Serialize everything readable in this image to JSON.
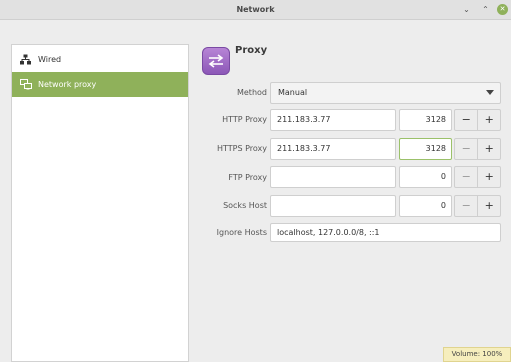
{
  "window": {
    "title": "Network",
    "minimize_glyph": "⌄",
    "maximize_glyph": "⌃",
    "close_glyph": "✕"
  },
  "sidebar": {
    "items": [
      {
        "label": "Wired",
        "icon": "network-wired-icon",
        "selected": false
      },
      {
        "label": "Network proxy",
        "icon": "network-proxy-icon",
        "selected": true
      }
    ]
  },
  "proxy": {
    "title": "Proxy",
    "method": {
      "label": "Method",
      "value": "Manual"
    },
    "http": {
      "label": "HTTP Proxy",
      "host": "211.183.3.77",
      "port": "3128"
    },
    "https": {
      "label": "HTTPS Proxy",
      "host": "211.183.3.77",
      "port": "3128"
    },
    "ftp": {
      "label": "FTP Proxy",
      "host": "",
      "port": "0"
    },
    "socks": {
      "label": "Socks Host",
      "host": "",
      "port": "0"
    },
    "ignore": {
      "label": "Ignore Hosts",
      "value": "localhost, 127.0.0.0/8, ::1"
    },
    "stepper": {
      "minus": "−",
      "plus": "+"
    }
  },
  "status": {
    "text": "Volume: 100%"
  },
  "colors": {
    "accent": "#8fb15a",
    "icon_purple": "#9a63c4",
    "status_bg": "#f6eebd"
  }
}
